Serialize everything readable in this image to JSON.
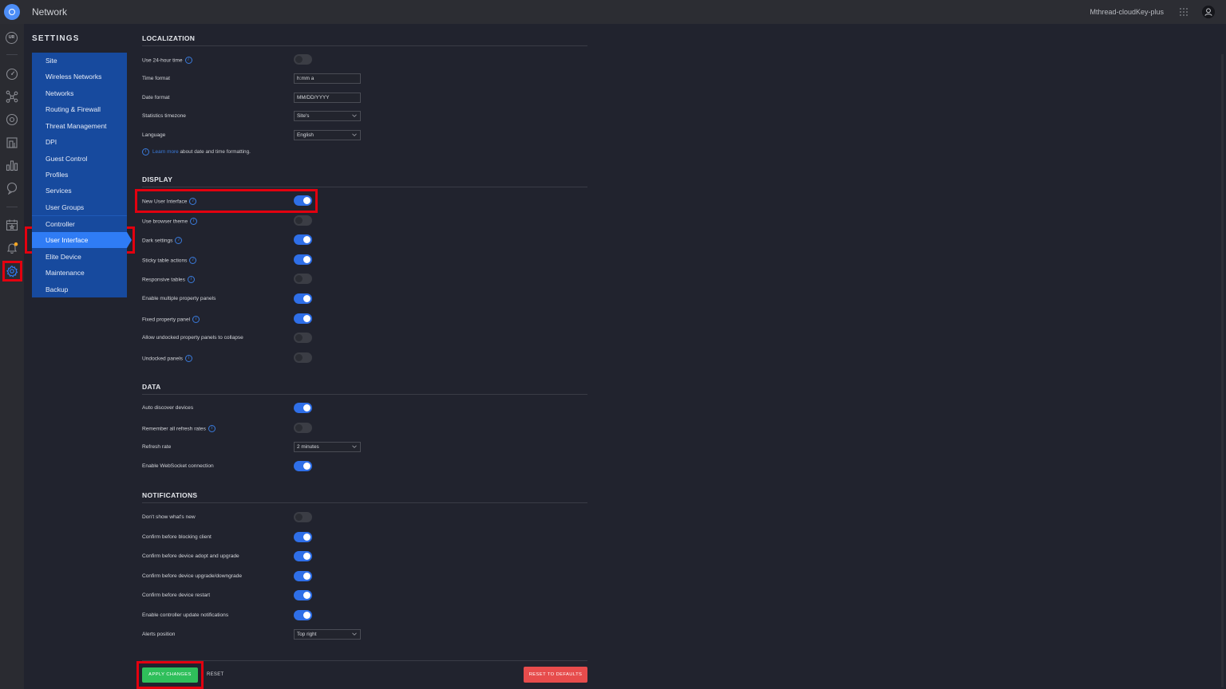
{
  "app": {
    "title": "Network",
    "controller": "Mthread-cloudKey-plus",
    "rail_badge": "UR"
  },
  "settings": {
    "heading": "SETTINGS",
    "nav": [
      {
        "label": "Site",
        "name": "nav-site"
      },
      {
        "label": "Wireless Networks",
        "name": "nav-wireless-networks"
      },
      {
        "label": "Networks",
        "name": "nav-networks"
      },
      {
        "label": "Routing & Firewall",
        "name": "nav-routing-firewall"
      },
      {
        "label": "Threat Management",
        "name": "nav-threat-management"
      },
      {
        "label": "DPI",
        "name": "nav-dpi"
      },
      {
        "label": "Guest Control",
        "name": "nav-guest-control"
      },
      {
        "label": "Profiles",
        "name": "nav-profiles"
      },
      {
        "label": "Services",
        "name": "nav-services"
      },
      {
        "label": "User Groups",
        "name": "nav-user-groups"
      },
      {
        "label": "Controller",
        "name": "nav-controller"
      },
      {
        "label": "User Interface",
        "name": "nav-user-interface",
        "active": true
      },
      {
        "label": "Elite Device",
        "name": "nav-elite-device"
      },
      {
        "label": "Maintenance",
        "name": "nav-maintenance"
      },
      {
        "label": "Backup",
        "name": "nav-backup"
      }
    ]
  },
  "localization": {
    "title": "LOCALIZATION",
    "use_24h_label": "Use 24-hour time",
    "use_24h_on": false,
    "time_format_label": "Time format",
    "time_format_value": "h:mm a",
    "date_format_label": "Date format",
    "date_format_value": "MM/DD/YYYY",
    "stats_tz_label": "Statistics timezone",
    "stats_tz_value": "Site's",
    "language_label": "Language",
    "language_value": "English",
    "learn_link": "Learn more",
    "learn_rest": "about date and time formatting."
  },
  "display": {
    "title": "DISPLAY",
    "rows": [
      {
        "label": "New User Interface",
        "info": true,
        "on": true
      },
      {
        "label": "Use browser theme",
        "info": true,
        "on": false
      },
      {
        "label": "Dark settings",
        "info": true,
        "on": true
      },
      {
        "label": "Sticky table actions",
        "info": true,
        "on": true
      },
      {
        "label": "Responsive tables",
        "info": true,
        "on": false
      },
      {
        "label": "Enable multiple property panels",
        "info": false,
        "on": true
      },
      {
        "label": "Fixed property panel",
        "info": true,
        "on": true
      },
      {
        "label": "Allow undocked property panels to collapse",
        "info": false,
        "on": false
      },
      {
        "label": "Undocked panels",
        "info": true,
        "on": false
      }
    ]
  },
  "data_section": {
    "title": "DATA",
    "auto_discover_label": "Auto discover devices",
    "auto_discover_on": true,
    "remember_label": "Remember all refresh rates",
    "remember_on": false,
    "refresh_label": "Refresh rate",
    "refresh_value": "2 minutes",
    "websocket_label": "Enable WebSocket connection",
    "websocket_on": true
  },
  "notifications": {
    "title": "NOTIFICATIONS",
    "rows": [
      {
        "label": "Don't show what's new",
        "on": false
      },
      {
        "label": "Confirm before blocking client",
        "on": true
      },
      {
        "label": "Confirm before device adopt and upgrade",
        "on": true
      },
      {
        "label": "Confirm before device upgrade/downgrade",
        "on": true
      },
      {
        "label": "Confirm before device restart",
        "on": true
      },
      {
        "label": "Enable controller update notifications",
        "on": true
      }
    ],
    "alerts_label": "Alerts position",
    "alerts_value": "Top right"
  },
  "actions": {
    "apply": "APPLY CHANGES",
    "reset": "RESET",
    "defaults": "RESET TO DEFAULTS"
  },
  "colors": {
    "accent": "#2f7cf5",
    "apply": "#2fbf5b",
    "danger": "#e74c4c",
    "highlight": "#e3000f"
  }
}
